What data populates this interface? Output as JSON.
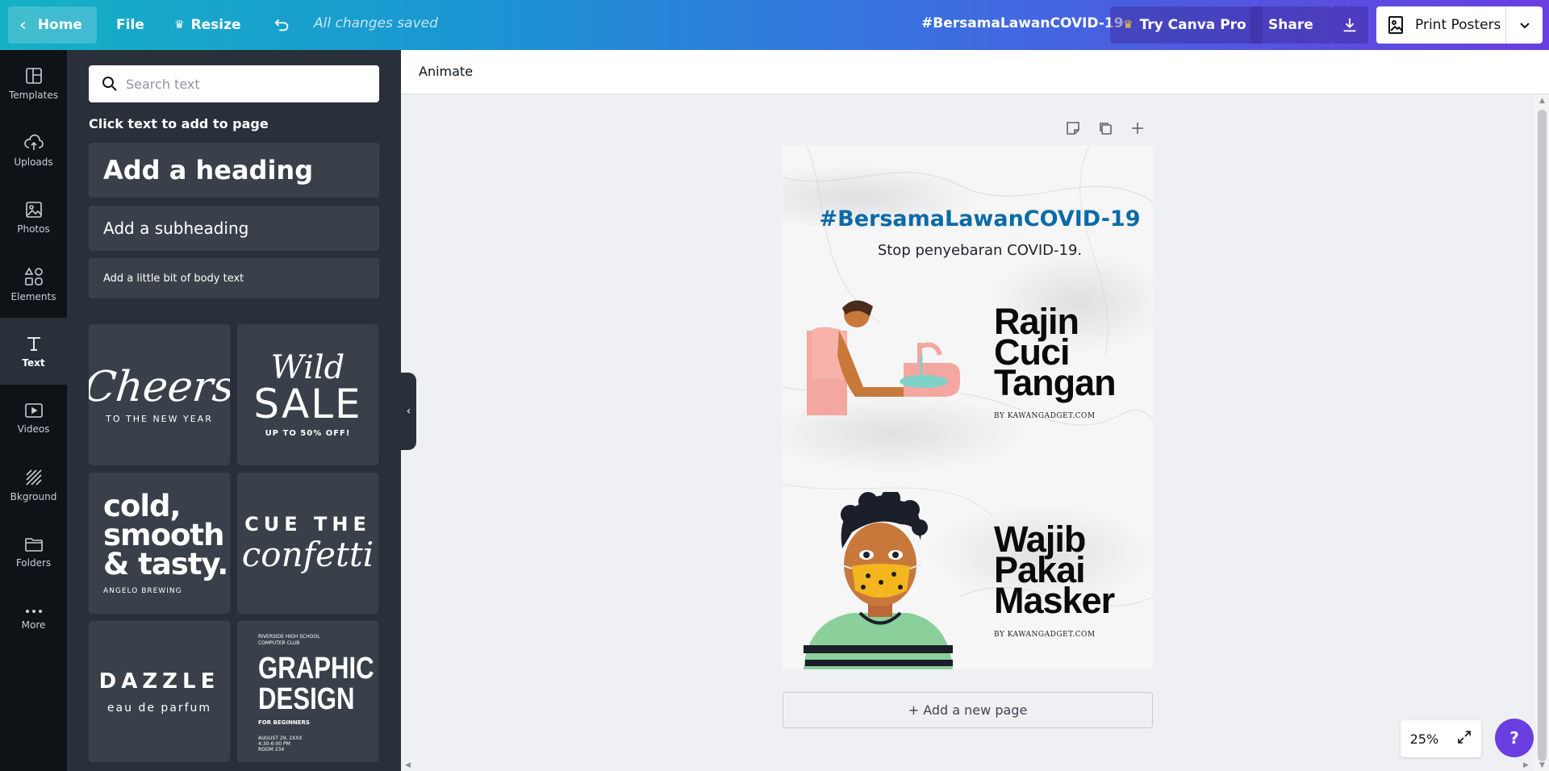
{
  "topbar": {
    "home_label": "Home",
    "file_label": "File",
    "resize_label": "Resize",
    "saved_status": "All changes saved",
    "doc_title": "#BersamaLawanCOVID-19",
    "pro_label": "Try Canva Pro",
    "share_label": "Share",
    "print_label": "Print Posters"
  },
  "rail": {
    "items": [
      {
        "label": "Templates",
        "icon": "templates-icon"
      },
      {
        "label": "Uploads",
        "icon": "upload-cloud-icon"
      },
      {
        "label": "Photos",
        "icon": "image-icon"
      },
      {
        "label": "Elements",
        "icon": "shapes-icon"
      },
      {
        "label": "Text",
        "icon": "text-icon"
      },
      {
        "label": "Videos",
        "icon": "video-icon"
      },
      {
        "label": "Bkground",
        "icon": "background-icon"
      },
      {
        "label": "Folders",
        "icon": "folder-icon"
      },
      {
        "label": "More",
        "icon": "more-icon"
      }
    ]
  },
  "panel": {
    "search_placeholder": "Search text",
    "hint": "Click text to add to page",
    "add_heading": "Add a heading",
    "add_subheading": "Add a subheading",
    "add_body": "Add a little bit of body text",
    "templates": {
      "cheers": {
        "main": "Cheers",
        "sub": "TO THE NEW YEAR"
      },
      "wild": {
        "main1": "Wild",
        "main2": "SALE",
        "sub": "UP TO 50% OFF!"
      },
      "cold": {
        "line1": "cold,",
        "line2": "smooth",
        "line3": "& tasty.",
        "sub": "ANGELO BREWING"
      },
      "confetti": {
        "line1": "CUE THE",
        "line2": "confetti"
      },
      "dazzle": {
        "line1": "DAZZLE",
        "line2": "eau de parfum"
      },
      "graphic": {
        "top": "RIVERSIDE HIGH SCHOOL COMPUTER CLUB",
        "line1": "GRAPHIC",
        "line2": "DESIGN",
        "sub": "FOR BEGINNERS",
        "date": "AUGUST 29, 2XXX",
        "time": "4:30-6:00 PM",
        "room": "ROOM 234"
      }
    }
  },
  "editor": {
    "animate_label": "Animate",
    "add_page_label": "+ Add a new page",
    "zoom": "25%",
    "help_label": "?"
  },
  "poster": {
    "title": "#BersamaLawanCOVID-19",
    "subtitle": "Stop penyebaran COVID-19.",
    "block1": {
      "line1": "Rajin",
      "line2": "Cuci",
      "line3": "Tangan",
      "by": "BY KAWANGADGET.COM"
    },
    "block2": {
      "line1": "Wajib",
      "line2": "Pakai",
      "line3": "Masker",
      "by": "BY KAWANGADGET.COM"
    }
  },
  "colors": {
    "accent": "#6a3ee0",
    "rail_bg": "#0e1318",
    "panel_bg": "#293039",
    "poster_title": "#0b6aa8"
  }
}
